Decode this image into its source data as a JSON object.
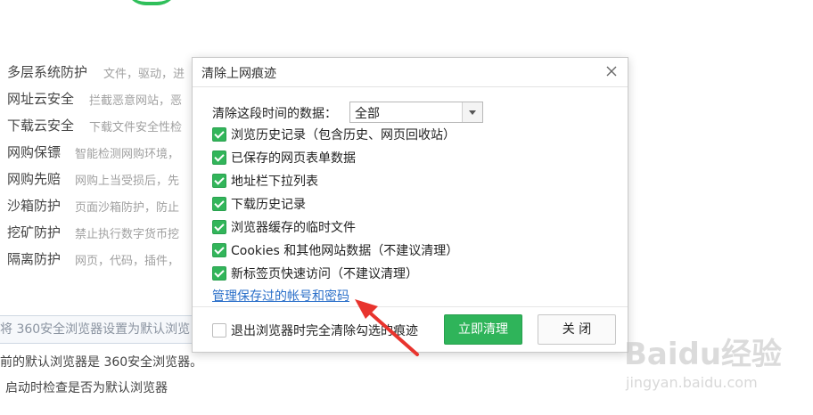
{
  "background": {
    "features": [
      {
        "name": "多层系统防护",
        "desc": "文件，驱动，进"
      },
      {
        "name": "网址云安全",
        "desc": "拦截恶意网站，恶"
      },
      {
        "name": "下载云安全",
        "desc": "下载文件安全性检"
      },
      {
        "name": "网购保镖",
        "desc": "智能检测网购环境，"
      },
      {
        "name": "网购先赔",
        "desc": "网购上当受损后，先"
      },
      {
        "name": "沙箱防护",
        "desc": "页面沙箱防护，防止"
      },
      {
        "name": "挖矿防护",
        "desc": "禁止执行数字货币挖"
      },
      {
        "name": "隔离防护",
        "desc": "网页，代码，插件，"
      }
    ],
    "set_default_text": "将 360安全浏览器设置为默认浏览",
    "default_browser_text": "前的默认浏览器是 360安全浏览器。",
    "startup_check_label": "启动时检查是否为默认浏览器"
  },
  "dialog": {
    "title": "清除上网痕迹",
    "range_label": "清除这段时间的数据：",
    "range_value": "全部",
    "options": [
      {
        "label": "浏览历史记录（包含历史、网页回收站）",
        "checked": true
      },
      {
        "label": "已保存的网页表单数据",
        "checked": true
      },
      {
        "label": "地址栏下拉列表",
        "checked": true
      },
      {
        "label": "下载历史记录",
        "checked": true
      },
      {
        "label": "浏览器缓存的临时文件",
        "checked": true
      },
      {
        "label": "Cookies 和其他网站数据（不建议清理）",
        "checked": true
      },
      {
        "label": "新标签页快速访问（不建议清理）",
        "checked": true
      }
    ],
    "manage_link": "管理保存过的帐号和密码",
    "exit_option": {
      "label": "退出浏览器时完全清除勾选的痕迹",
      "checked": false
    },
    "clear_button": "立即清理",
    "close_button": "关 闭"
  },
  "watermark": {
    "logo": "Baidu经验",
    "sub": "jingyan.baidu.com"
  },
  "colors": {
    "accent_green": "#2fb45a",
    "link_blue": "#2a6fc9",
    "arrow_red": "#e8342e"
  }
}
